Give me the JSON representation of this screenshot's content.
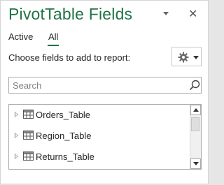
{
  "pane": {
    "title": "PivotTable Fields",
    "title_icon_dropdown": "chevron-down-icon",
    "close_icon": "close-icon"
  },
  "tabs": [
    {
      "label": "Active",
      "selected": false
    },
    {
      "label": "All",
      "selected": true
    }
  ],
  "prompt": "Choose fields to add to report:",
  "tools_button": {
    "icon": "gear-icon",
    "dropdown_icon": "chevron-down-icon"
  },
  "search": {
    "placeholder": "Search",
    "value": "",
    "icon": "search-icon"
  },
  "fields": [
    {
      "label": "Orders_Table",
      "icon": "table-icon",
      "expanded": false
    },
    {
      "label": "Region_Table",
      "icon": "table-icon",
      "expanded": false
    },
    {
      "label": "Returns_Table",
      "icon": "table-icon",
      "expanded": false
    }
  ],
  "colors": {
    "accent": "#217346",
    "text": "#262626",
    "border": "#ababab"
  }
}
